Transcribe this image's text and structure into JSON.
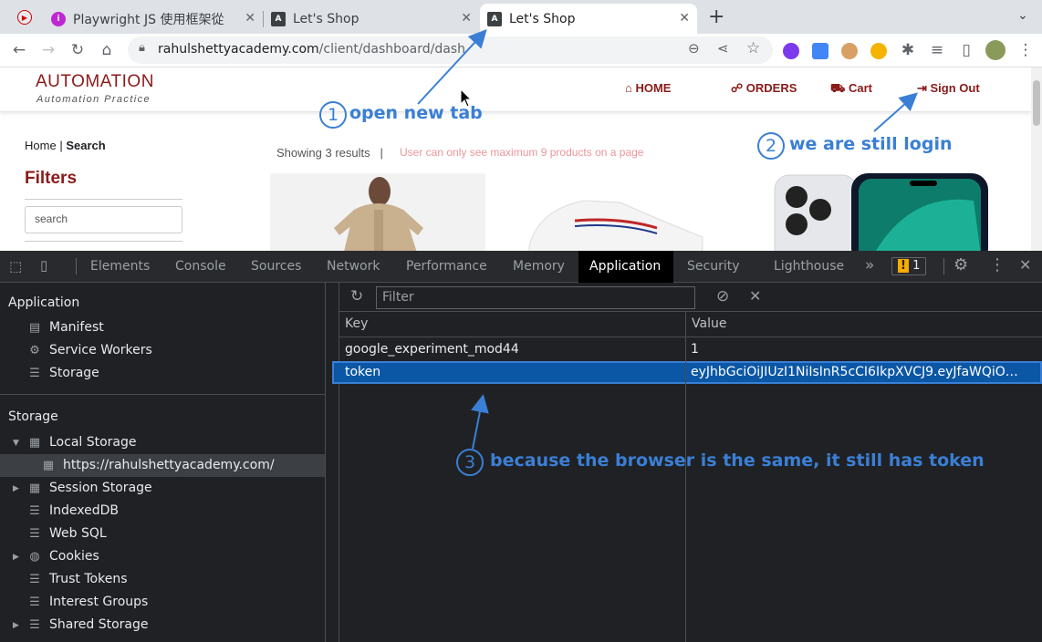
{
  "browser": {
    "tabs": [
      {
        "title": "Playwright JS 使用框架從",
        "favicon": "playwright-icon",
        "active": false
      },
      {
        "title": "Let's Shop",
        "favicon": "angular-icon",
        "active": false
      },
      {
        "title": "Let's Shop",
        "favicon": "angular-icon",
        "active": true
      }
    ],
    "new_tab_label": "+",
    "url_host": "rahulshettyacademy.com",
    "url_path": "/client/dashboard/dash"
  },
  "page": {
    "logo_title": "AUTOMATION",
    "logo_subtitle": "Automation Practice",
    "nav": {
      "home": "HOME",
      "orders": "ORDERS",
      "cart": "Cart",
      "signout": "Sign Out"
    },
    "breadcrumb_home": "Home",
    "breadcrumb_sep": "|",
    "breadcrumb_current": "Search",
    "filters_title": "Filters",
    "search_placeholder": "search",
    "showing_text": "Showing 3 results",
    "showing_sep": "|",
    "limit_text": "User can only see maximum 9 products on a page"
  },
  "annotations": [
    {
      "number": "1",
      "text": "open new tab"
    },
    {
      "number": "2",
      "text": "we are still login"
    },
    {
      "number": "3",
      "text": "because the browser is the same, it still has token"
    }
  ],
  "devtools": {
    "tabs": [
      "Elements",
      "Console",
      "Sources",
      "Network",
      "Performance",
      "Memory",
      "Application",
      "Security",
      "Lighthouse"
    ],
    "active_tab": "Application",
    "more_label": "»",
    "issues_count": "1",
    "sidebar": {
      "application_header": "Application",
      "application_items": [
        "Manifest",
        "Service Workers",
        "Storage"
      ],
      "storage_header": "Storage",
      "local_storage": "Local Storage",
      "local_storage_origin": "https://rahulshettyacademy.com/",
      "storage_items": [
        "Session Storage",
        "IndexedDB",
        "Web SQL",
        "Cookies",
        "Trust Tokens",
        "Interest Groups",
        "Shared Storage"
      ]
    },
    "filter_placeholder": "Filter",
    "columns": {
      "key": "Key",
      "value": "Value"
    },
    "rows": [
      {
        "key": "google_experiment_mod44",
        "value": "1",
        "selected": false
      },
      {
        "key": "token",
        "value": "eyJhbGciOiJIUzI1NiIsInR5cCI6IkpXVCJ9.eyJfaWQiO…",
        "selected": true
      }
    ]
  }
}
